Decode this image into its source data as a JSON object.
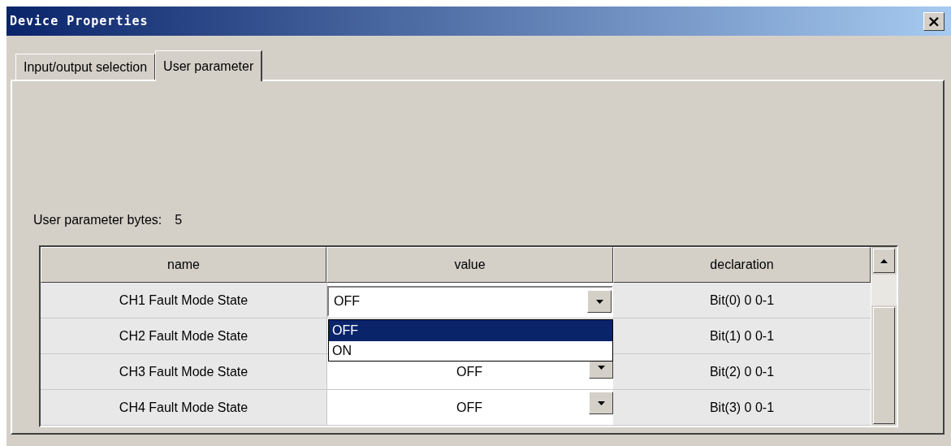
{
  "window": {
    "title": "Device Properties",
    "close": "×"
  },
  "tabs": [
    {
      "label": "Input/output selection",
      "selected": false
    },
    {
      "label": "User parameter",
      "selected": true
    }
  ],
  "parameter_bytes": {
    "label": "User parameter bytes:",
    "value": "5"
  },
  "table": {
    "columns": [
      "name",
      "value",
      "declaration"
    ],
    "rows": [
      {
        "name": "CH1 Fault Mode State",
        "kind": "editing",
        "value": "OFF",
        "declaration": "Bit(0) 0 0-1"
      },
      {
        "name": "CH2 Fault Mode State",
        "kind": "covered",
        "declaration": "Bit(1) 0 0-1"
      },
      {
        "name": "CH3 Fault Mode State",
        "kind": "plain",
        "value": "OFF",
        "declaration": "Bit(2) 0 0-1"
      },
      {
        "name": "CH4 Fault Mode State",
        "kind": "plain",
        "value": "OFF",
        "declaration": "Bit(3) 0 0-1"
      }
    ],
    "dropdown": {
      "options": [
        {
          "label": "OFF",
          "selected": true
        },
        {
          "label": "ON",
          "selected": false
        }
      ]
    }
  }
}
